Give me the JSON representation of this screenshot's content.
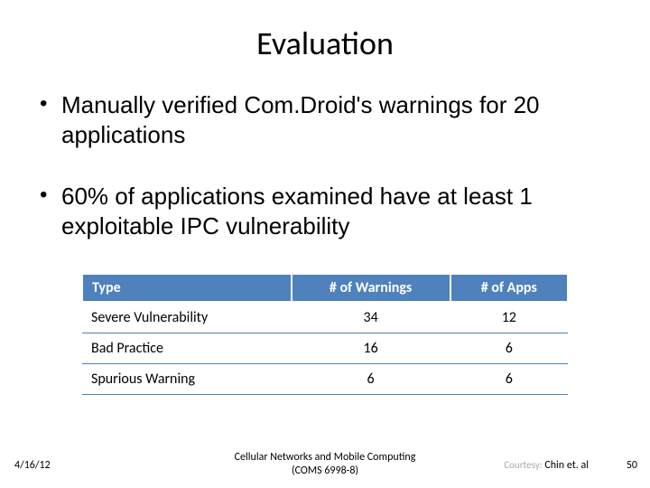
{
  "title": "Evaluation",
  "bullets": [
    "Manually verified Com.Droid's warnings for 20 applications",
    "60% of applications examined have at least 1  exploitable IPC vulnerability"
  ],
  "table": {
    "headers": [
      "Type",
      "# of Warnings",
      "# of Apps"
    ],
    "rows": [
      [
        "Severe Vulnerability",
        "34",
        "12"
      ],
      [
        "Bad Practice",
        "16",
        "6"
      ],
      [
        "Spurious Warning",
        "6",
        "6"
      ]
    ]
  },
  "footer": {
    "date": "4/16/12",
    "center_line1": "Cellular Networks and Mobile Computing",
    "center_line2": "(COMS 6998-8)",
    "courtesy_label": "Courtesy:",
    "courtesy_name": "Chin et. al",
    "pagenum": "50"
  },
  "chart_data": {
    "type": "table",
    "title": "Evaluation",
    "columns": [
      "Type",
      "# of Warnings",
      "# of Apps"
    ],
    "rows": [
      {
        "Type": "Severe Vulnerability",
        "# of Warnings": 34,
        "# of Apps": 12
      },
      {
        "Type": "Bad Practice",
        "# of Warnings": 16,
        "# of Apps": 6
      },
      {
        "Type": "Spurious Warning",
        "# of Warnings": 6,
        "# of Apps": 6
      }
    ]
  }
}
